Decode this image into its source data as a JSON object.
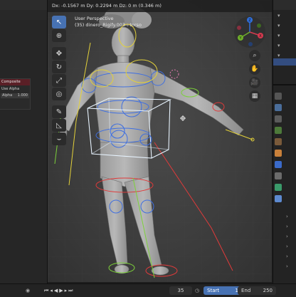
{
  "viewport": {
    "header_readout": "Dx: -0.1567 m    Dy: 0.2294 m    Dz: 0 m (0.346 m)",
    "view_name": "User Perspective",
    "object_context": "(35) dinero_Rigify.003 : torso",
    "tools": [
      {
        "icon": "cursor-select-icon",
        "glyph": "↖",
        "active": true
      },
      {
        "icon": "cursor-3d-icon",
        "glyph": "⊕",
        "active": false
      },
      {
        "icon": "move-icon",
        "glyph": "✥",
        "active": false
      },
      {
        "icon": "rotate-icon",
        "glyph": "↻",
        "active": false
      },
      {
        "icon": "scale-icon",
        "glyph": "⤢",
        "active": false
      },
      {
        "icon": "transform-icon",
        "glyph": "◎",
        "active": false
      },
      {
        "icon": "annotate-icon",
        "glyph": "✎",
        "active": false
      },
      {
        "icon": "measure-icon",
        "glyph": "◺",
        "active": false
      },
      {
        "icon": "bone-roll-icon",
        "glyph": "⌣",
        "active": false
      }
    ],
    "gizmo_axes": [
      {
        "label": "Z",
        "color": "#2f6fdb"
      },
      {
        "label": "Y",
        "color": "#6fb02a"
      },
      {
        "label": "X",
        "color": "#d43a4f"
      }
    ],
    "nav_buttons": [
      "zoom-icon",
      "pan-hand-icon",
      "camera-icon",
      "grid-toggle-icon"
    ],
    "nav_glyphs": [
      "⌕",
      "✋",
      "🎥",
      "▦"
    ]
  },
  "compositor": {
    "title": "Composite",
    "option": "Use Alpha",
    "field_label": "Alpha",
    "field_value": "1.000"
  },
  "timeline": {
    "current_frame": "35",
    "start_label": "Start",
    "start_value": "1",
    "end_label": "End",
    "end_value": "250"
  },
  "colors": {
    "accent": "#4772b3",
    "bone_blue": "#3f6fe0",
    "bone_green": "#7cd13a",
    "bone_red": "#e03a3a",
    "bone_yellow": "#e3d13a",
    "selection": "#e8f4ff"
  }
}
